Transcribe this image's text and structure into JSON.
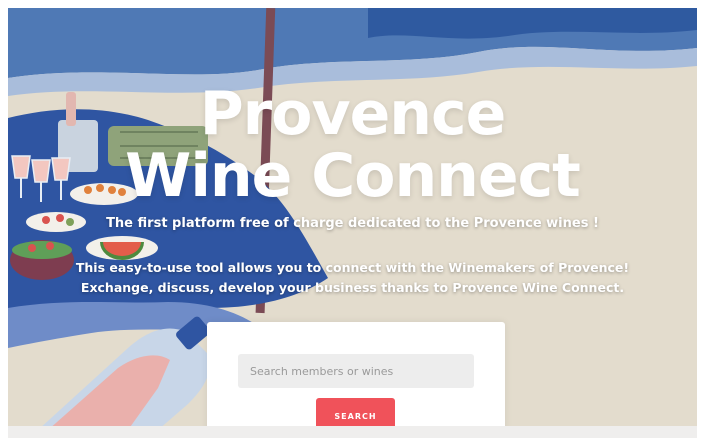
{
  "hero": {
    "title_line1": "Provence",
    "title_line2": "Wine Connect",
    "tagline": "The first platform free of charge dedicated to the Provence wines !",
    "desc_line1": "This easy-to-use tool allows you to connect with the Winemakers of Provence!",
    "desc_line2_prefix": "Exchange, discuss, develop your business thanks to ",
    "desc_line2_brand": "Provence Wine Connect",
    "desc_line2_suffix": "."
  },
  "search": {
    "placeholder": "Search members or wines",
    "button_label": "SEARCH"
  },
  "colors": {
    "accent": "#f0525a",
    "sky": "#4f79b5",
    "tablecloth": "#2f55a2",
    "sand": "#e6dfd1"
  }
}
